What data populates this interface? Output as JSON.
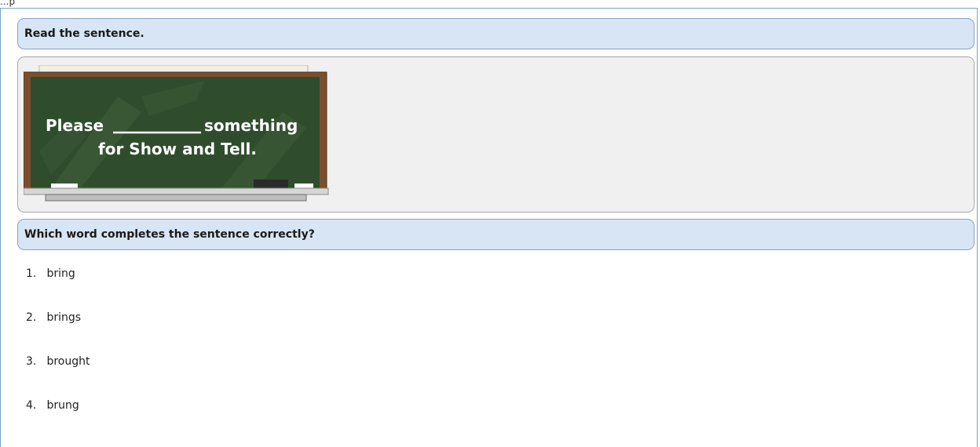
{
  "header_cut_text": "...p",
  "prompt": "Read the sentence.",
  "stimulus": {
    "line1_start": "Please",
    "line1_end": "something",
    "line2": "for Show and Tell."
  },
  "question": "Which word completes the sentence correctly?",
  "options": [
    {
      "number": "1.",
      "label": "bring"
    },
    {
      "number": "2.",
      "label": "brings"
    },
    {
      "number": "3.",
      "label": "brought"
    },
    {
      "number": "4.",
      "label": "brung"
    }
  ]
}
